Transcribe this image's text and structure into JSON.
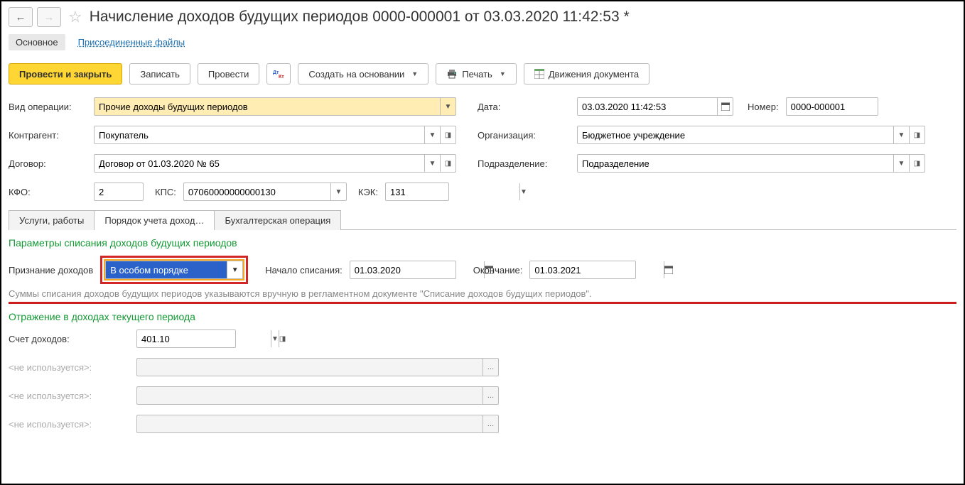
{
  "title": "Начисление доходов будущих периодов 0000-000001 от 03.03.2020 11:42:53 *",
  "subnav": {
    "main": "Основное",
    "files": "Присоединенные файлы"
  },
  "toolbar": {
    "post_close": "Провести и закрыть",
    "save": "Записать",
    "post": "Провести",
    "create_based": "Создать на основании",
    "print": "Печать",
    "movements": "Движения документа"
  },
  "labels": {
    "op_type": "Вид операции:",
    "date": "Дата:",
    "number": "Номер:",
    "contractor": "Контрагент:",
    "org": "Организация:",
    "contract": "Договор:",
    "dept": "Подразделение:",
    "kfo": "КФО:",
    "kps": "КПС:",
    "kek": "КЭК:"
  },
  "fields": {
    "op_type": "Прочие доходы будущих периодов",
    "date": "03.03.2020 11:42:53",
    "number": "0000-000001",
    "contractor": "Покупатель",
    "org": "Бюджетное учреждение",
    "contract": "Договор от 01.03.2020 № 65",
    "dept": "Подразделение",
    "kfo": "2",
    "kps": "07060000000000130",
    "kek": "131"
  },
  "tabs": {
    "services": "Услуги, работы",
    "order": "Порядок учета доход…",
    "accounting": "Бухгалтерская операция"
  },
  "order_tab": {
    "section1": "Параметры списания доходов будущих периодов",
    "recognition_lbl": "Признание доходов",
    "recognition_val": "В особом порядке",
    "start_lbl": "Начало списания:",
    "start_val": "01.03.2020",
    "end_lbl": "Окончание:",
    "end_val": "01.03.2021",
    "note": "Суммы списания доходов будущих периодов указываются вручную в регламентном документе \"Списание доходов будущих периодов\".",
    "section2": "Отражение в доходах текущего периода",
    "acc_lbl": "Счет доходов:",
    "acc_val": "401.10",
    "unused": "<не используется>:"
  }
}
